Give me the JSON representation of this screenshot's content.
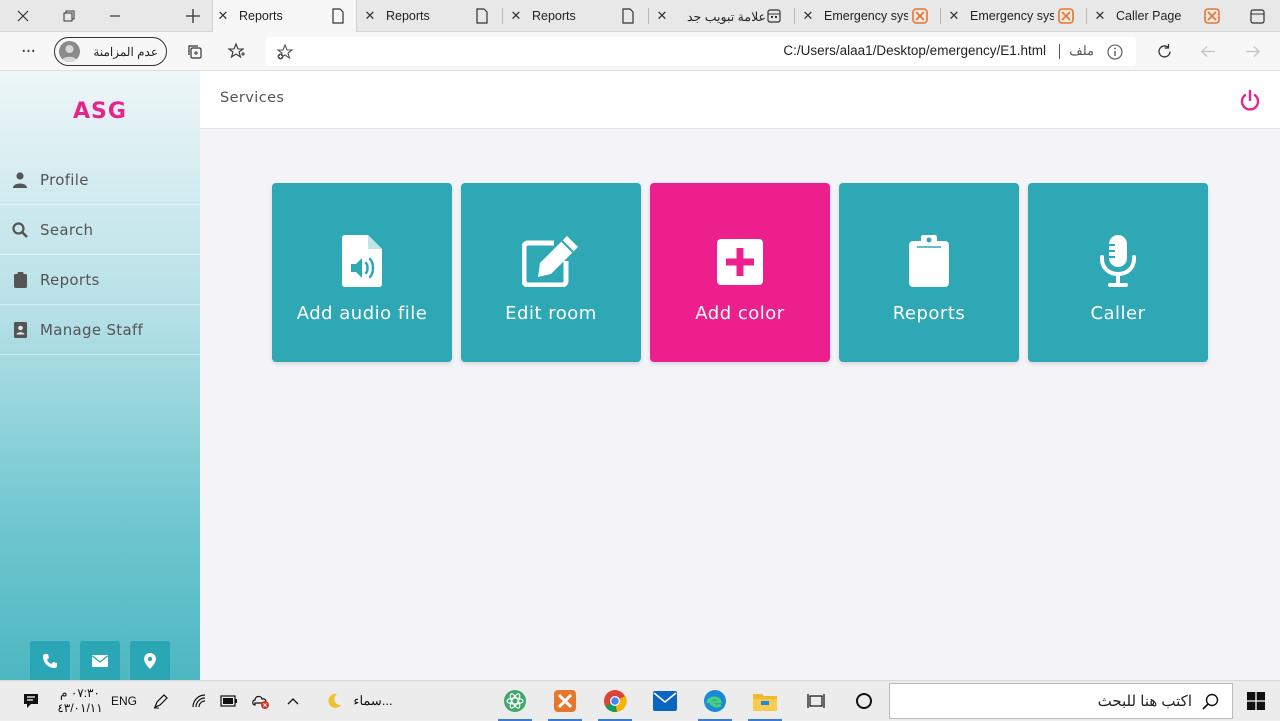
{
  "browser": {
    "tabs": [
      {
        "label": "Reports",
        "active": true
      },
      {
        "label": "Reports",
        "active": false
      },
      {
        "label": "Reports",
        "active": false
      },
      {
        "label": "علامة تبويب جد",
        "active": false
      },
      {
        "label": "Emergency sys",
        "active": false
      },
      {
        "label": "Emergency sys",
        "active": false
      },
      {
        "label": "Caller Page",
        "active": false
      }
    ],
    "profile_label": "عدم المزامنة",
    "url": "C:/Users/alaa1/Desktop/emergency/E1.html",
    "url_scheme_label": "ملف"
  },
  "app": {
    "brand": "ASG",
    "breadcrumb": "Services",
    "sidebar": {
      "items": [
        {
          "label": "Profile",
          "icon": "user-icon"
        },
        {
          "label": "Search",
          "icon": "search-icon"
        },
        {
          "label": "Reports",
          "icon": "clipboard-icon"
        },
        {
          "label": "Manage Staff",
          "icon": "id-badge-icon"
        }
      ],
      "social": [
        "phone-icon",
        "envelope-icon",
        "map-marker-icon"
      ]
    },
    "cards": [
      {
        "label": "Add audio file",
        "icon": "audio-file-icon",
        "color": "#2fa8b5"
      },
      {
        "label": "Edit room",
        "icon": "edit-icon",
        "color": "#2fa8b5"
      },
      {
        "label": "Add color",
        "icon": "plus-square-icon",
        "color": "#ec1f8c"
      },
      {
        "label": "Reports",
        "icon": "clipboard-icon",
        "color": "#2fa8b5"
      },
      {
        "label": "Caller",
        "icon": "microphone-icon",
        "color": "#2fa8b5"
      }
    ],
    "colors": {
      "accent": "#e5258c",
      "teal": "#2fa8b5"
    }
  },
  "taskbar": {
    "time": "٠٧:٣٠ م",
    "date": "٤٣/٠١/١١",
    "lang": "ENG",
    "weather": "سماء...",
    "search_placeholder": "اكتب هنا للبحث"
  }
}
